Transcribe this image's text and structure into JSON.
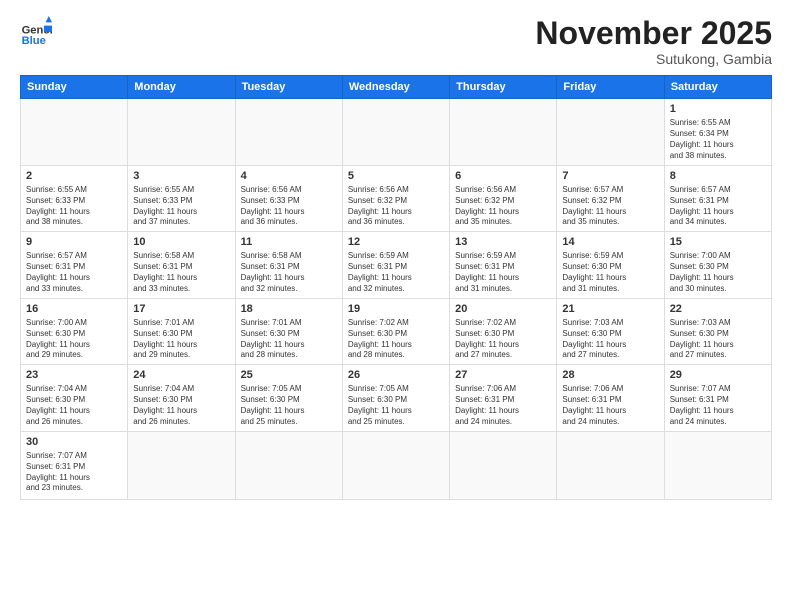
{
  "header": {
    "logo_general": "General",
    "logo_blue": "Blue",
    "month": "November 2025",
    "location": "Sutukong, Gambia"
  },
  "days_of_week": [
    "Sunday",
    "Monday",
    "Tuesday",
    "Wednesday",
    "Thursday",
    "Friday",
    "Saturday"
  ],
  "weeks": [
    [
      {
        "day": "",
        "info": ""
      },
      {
        "day": "",
        "info": ""
      },
      {
        "day": "",
        "info": ""
      },
      {
        "day": "",
        "info": ""
      },
      {
        "day": "",
        "info": ""
      },
      {
        "day": "",
        "info": ""
      },
      {
        "day": "1",
        "info": "Sunrise: 6:55 AM\nSunset: 6:34 PM\nDaylight: 11 hours\nand 38 minutes."
      }
    ],
    [
      {
        "day": "2",
        "info": "Sunrise: 6:55 AM\nSunset: 6:33 PM\nDaylight: 11 hours\nand 38 minutes."
      },
      {
        "day": "3",
        "info": "Sunrise: 6:55 AM\nSunset: 6:33 PM\nDaylight: 11 hours\nand 37 minutes."
      },
      {
        "day": "4",
        "info": "Sunrise: 6:56 AM\nSunset: 6:33 PM\nDaylight: 11 hours\nand 36 minutes."
      },
      {
        "day": "5",
        "info": "Sunrise: 6:56 AM\nSunset: 6:32 PM\nDaylight: 11 hours\nand 36 minutes."
      },
      {
        "day": "6",
        "info": "Sunrise: 6:56 AM\nSunset: 6:32 PM\nDaylight: 11 hours\nand 35 minutes."
      },
      {
        "day": "7",
        "info": "Sunrise: 6:57 AM\nSunset: 6:32 PM\nDaylight: 11 hours\nand 35 minutes."
      },
      {
        "day": "8",
        "info": "Sunrise: 6:57 AM\nSunset: 6:31 PM\nDaylight: 11 hours\nand 34 minutes."
      }
    ],
    [
      {
        "day": "9",
        "info": "Sunrise: 6:57 AM\nSunset: 6:31 PM\nDaylight: 11 hours\nand 33 minutes."
      },
      {
        "day": "10",
        "info": "Sunrise: 6:58 AM\nSunset: 6:31 PM\nDaylight: 11 hours\nand 33 minutes."
      },
      {
        "day": "11",
        "info": "Sunrise: 6:58 AM\nSunset: 6:31 PM\nDaylight: 11 hours\nand 32 minutes."
      },
      {
        "day": "12",
        "info": "Sunrise: 6:59 AM\nSunset: 6:31 PM\nDaylight: 11 hours\nand 32 minutes."
      },
      {
        "day": "13",
        "info": "Sunrise: 6:59 AM\nSunset: 6:31 PM\nDaylight: 11 hours\nand 31 minutes."
      },
      {
        "day": "14",
        "info": "Sunrise: 6:59 AM\nSunset: 6:30 PM\nDaylight: 11 hours\nand 31 minutes."
      },
      {
        "day": "15",
        "info": "Sunrise: 7:00 AM\nSunset: 6:30 PM\nDaylight: 11 hours\nand 30 minutes."
      }
    ],
    [
      {
        "day": "16",
        "info": "Sunrise: 7:00 AM\nSunset: 6:30 PM\nDaylight: 11 hours\nand 29 minutes."
      },
      {
        "day": "17",
        "info": "Sunrise: 7:01 AM\nSunset: 6:30 PM\nDaylight: 11 hours\nand 29 minutes."
      },
      {
        "day": "18",
        "info": "Sunrise: 7:01 AM\nSunset: 6:30 PM\nDaylight: 11 hours\nand 28 minutes."
      },
      {
        "day": "19",
        "info": "Sunrise: 7:02 AM\nSunset: 6:30 PM\nDaylight: 11 hours\nand 28 minutes."
      },
      {
        "day": "20",
        "info": "Sunrise: 7:02 AM\nSunset: 6:30 PM\nDaylight: 11 hours\nand 27 minutes."
      },
      {
        "day": "21",
        "info": "Sunrise: 7:03 AM\nSunset: 6:30 PM\nDaylight: 11 hours\nand 27 minutes."
      },
      {
        "day": "22",
        "info": "Sunrise: 7:03 AM\nSunset: 6:30 PM\nDaylight: 11 hours\nand 27 minutes."
      }
    ],
    [
      {
        "day": "23",
        "info": "Sunrise: 7:04 AM\nSunset: 6:30 PM\nDaylight: 11 hours\nand 26 minutes."
      },
      {
        "day": "24",
        "info": "Sunrise: 7:04 AM\nSunset: 6:30 PM\nDaylight: 11 hours\nand 26 minutes."
      },
      {
        "day": "25",
        "info": "Sunrise: 7:05 AM\nSunset: 6:30 PM\nDaylight: 11 hours\nand 25 minutes."
      },
      {
        "day": "26",
        "info": "Sunrise: 7:05 AM\nSunset: 6:30 PM\nDaylight: 11 hours\nand 25 minutes."
      },
      {
        "day": "27",
        "info": "Sunrise: 7:06 AM\nSunset: 6:31 PM\nDaylight: 11 hours\nand 24 minutes."
      },
      {
        "day": "28",
        "info": "Sunrise: 7:06 AM\nSunset: 6:31 PM\nDaylight: 11 hours\nand 24 minutes."
      },
      {
        "day": "29",
        "info": "Sunrise: 7:07 AM\nSunset: 6:31 PM\nDaylight: 11 hours\nand 24 minutes."
      }
    ],
    [
      {
        "day": "30",
        "info": "Sunrise: 7:07 AM\nSunset: 6:31 PM\nDaylight: 11 hours\nand 23 minutes."
      },
      {
        "day": "",
        "info": ""
      },
      {
        "day": "",
        "info": ""
      },
      {
        "day": "",
        "info": ""
      },
      {
        "day": "",
        "info": ""
      },
      {
        "day": "",
        "info": ""
      },
      {
        "day": "",
        "info": ""
      }
    ]
  ]
}
